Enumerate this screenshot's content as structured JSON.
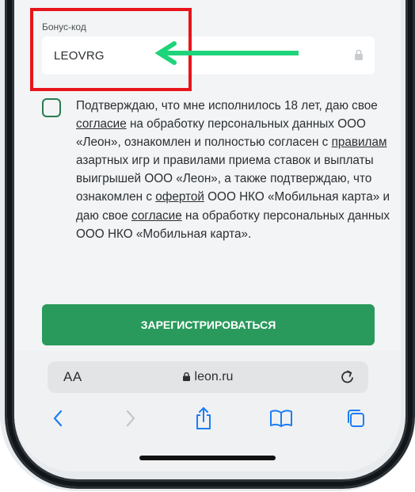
{
  "form": {
    "bonus_label": "Бонус-код",
    "bonus_value": "LEOVRG",
    "consent_parts": [
      {
        "t": "Подтверждаю, что мне исполнилось 18 лет, даю свое ",
        "u": false
      },
      {
        "t": "согласие",
        "u": true
      },
      {
        "t": " на обработку персональных данных ООО «Леон», ознакомлен и полностью согласен с ",
        "u": false
      },
      {
        "t": "правилам",
        "u": true
      },
      {
        "t": " азартных игр и правилами приема ставок и выплаты выигрышей ООО «Леон», а также подтверждаю, что ознакомлен с ",
        "u": false
      },
      {
        "t": "офертой",
        "u": true
      },
      {
        "t": " ООО НКО «Мобильная карта» и даю свое ",
        "u": false
      },
      {
        "t": "согласие",
        "u": true
      },
      {
        "t": " на обработку персональных данных ООО НКО «Мобильная карта».",
        "u": false
      }
    ],
    "register_label": "ЗАРЕГИСТРИРОВАТЬСЯ"
  },
  "browser": {
    "text_size_label": "AA",
    "url": "leon.ru"
  },
  "colors": {
    "accent_green": "#2a9a5c",
    "annotation_red": "#e8141b",
    "annotation_arrow": "#1ed47a"
  },
  "icons": [
    "lock-icon",
    "reload-icon",
    "back-icon",
    "forward-icon",
    "share-icon",
    "bookmarks-icon",
    "tabs-icon",
    "arrow-annotation-icon"
  ]
}
